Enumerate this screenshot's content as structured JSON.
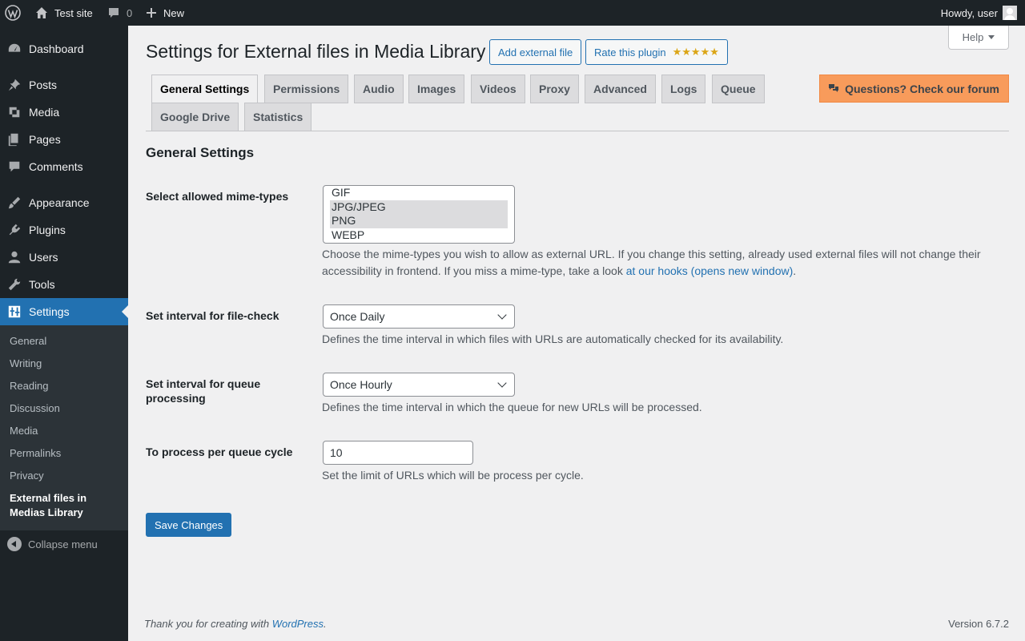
{
  "adminbar": {
    "site_name": "Test site",
    "comments_count": "0",
    "new_label": "New",
    "howdy": "Howdy, user"
  },
  "sidebar": {
    "items": [
      {
        "label": "Dashboard",
        "icon": "dashboard-icon"
      },
      {
        "label": "Posts",
        "icon": "pin-icon"
      },
      {
        "label": "Media",
        "icon": "media-icon"
      },
      {
        "label": "Pages",
        "icon": "page-icon"
      },
      {
        "label": "Comments",
        "icon": "comment-icon"
      },
      {
        "label": "Appearance",
        "icon": "brush-icon"
      },
      {
        "label": "Plugins",
        "icon": "plugin-icon"
      },
      {
        "label": "Users",
        "icon": "user-icon"
      },
      {
        "label": "Tools",
        "icon": "wrench-icon"
      },
      {
        "label": "Settings",
        "icon": "settings-icon"
      }
    ],
    "submenu": [
      "General",
      "Writing",
      "Reading",
      "Discussion",
      "Media",
      "Permalinks",
      "Privacy",
      "External files in Medias Library"
    ],
    "collapse_label": "Collapse menu"
  },
  "header": {
    "help_label": "Help",
    "title": "Settings for External files in Media Library",
    "add_external_label": "Add external file",
    "rate_label": "Rate this plugin",
    "stars": "★★★★★"
  },
  "tabs": {
    "row1": [
      "General Settings",
      "Permissions",
      "Audio",
      "Images",
      "Videos",
      "Proxy",
      "Advanced",
      "Logs",
      "Queue"
    ],
    "row2": [
      "Google Drive",
      "Statistics"
    ],
    "forum_label": "Questions? Check our forum"
  },
  "section_title": "General Settings",
  "fields": {
    "mime": {
      "label": "Select allowed mime-types",
      "options": [
        "GIF",
        "JPG/JPEG",
        "PNG",
        "WEBP"
      ],
      "selected": [
        "JPG/JPEG",
        "PNG"
      ],
      "desc": "Choose the mime-types you wish to allow as external URL. If you change this setting, already used external files will not change their accessibility in frontend. If you miss a mime-type, take a look ",
      "link": "at our hooks (opens new window)",
      "desc_end": "."
    },
    "filecheck": {
      "label": "Set interval for file-check",
      "value": "Once Daily",
      "desc": "Defines the time interval in which files with URLs are automatically checked for its availability."
    },
    "queue": {
      "label": "Set interval for queue processing",
      "value": "Once Hourly",
      "desc": "Defines the time interval in which the queue for new URLs will be processed."
    },
    "per_cycle": {
      "label": "To process per queue cycle",
      "value": "10",
      "desc": "Set the limit of URLs which will be process per cycle."
    }
  },
  "save_label": "Save Changes",
  "footer": {
    "thanks": "Thank you for creating with ",
    "wp_link": "WordPress",
    "thanks_end": ".",
    "version": "Version 6.7.2"
  }
}
